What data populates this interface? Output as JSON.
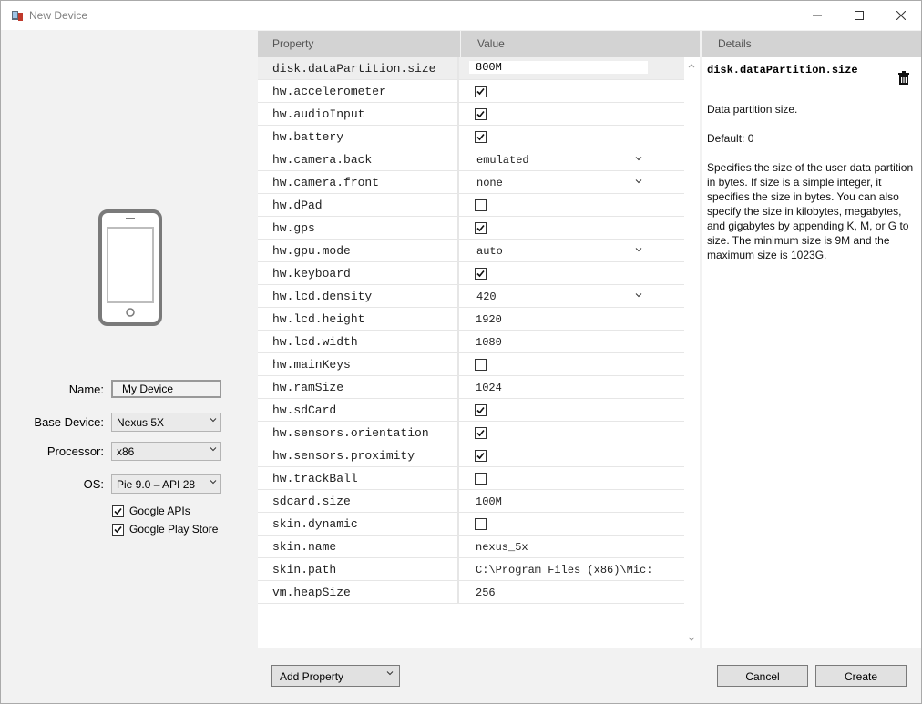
{
  "window": {
    "title": "New Device",
    "icons": [
      "app-icon",
      "minimize-icon",
      "maximize-icon",
      "close-icon"
    ]
  },
  "form": {
    "name_label": "Name:",
    "name_value": "My Device",
    "base_device_label": "Base Device:",
    "base_device_value": "Nexus 5X",
    "processor_label": "Processor:",
    "processor_value": "x86",
    "os_label": "OS:",
    "os_value": "Pie 9.0 – API 28",
    "google_apis_label": "Google APIs",
    "google_apis_checked": true,
    "google_play_label": "Google Play Store",
    "google_play_checked": true
  },
  "grid": {
    "header_property": "Property",
    "header_value": "Value",
    "rows": [
      {
        "name": "disk.dataPartition.size",
        "type": "text",
        "value": "800M",
        "selected": true
      },
      {
        "name": "hw.accelerometer",
        "type": "check",
        "checked": true
      },
      {
        "name": "hw.audioInput",
        "type": "check",
        "checked": true
      },
      {
        "name": "hw.battery",
        "type": "check",
        "checked": true
      },
      {
        "name": "hw.camera.back",
        "type": "combo",
        "value": "emulated"
      },
      {
        "name": "hw.camera.front",
        "type": "combo",
        "value": "none"
      },
      {
        "name": "hw.dPad",
        "type": "check",
        "checked": false
      },
      {
        "name": "hw.gps",
        "type": "check",
        "checked": true
      },
      {
        "name": "hw.gpu.mode",
        "type": "combo",
        "value": "auto"
      },
      {
        "name": "hw.keyboard",
        "type": "check",
        "checked": true
      },
      {
        "name": "hw.lcd.density",
        "type": "combo",
        "value": "420"
      },
      {
        "name": "hw.lcd.height",
        "type": "text",
        "value": "1920"
      },
      {
        "name": "hw.lcd.width",
        "type": "text",
        "value": "1080"
      },
      {
        "name": "hw.mainKeys",
        "type": "check",
        "checked": false
      },
      {
        "name": "hw.ramSize",
        "type": "text",
        "value": "1024"
      },
      {
        "name": "hw.sdCard",
        "type": "check",
        "checked": true
      },
      {
        "name": "hw.sensors.orientation",
        "type": "check",
        "checked": true
      },
      {
        "name": "hw.sensors.proximity",
        "type": "check",
        "checked": true
      },
      {
        "name": "hw.trackBall",
        "type": "check",
        "checked": false
      },
      {
        "name": "sdcard.size",
        "type": "text",
        "value": "100M"
      },
      {
        "name": "skin.dynamic",
        "type": "check",
        "checked": false
      },
      {
        "name": "skin.name",
        "type": "text",
        "value": "nexus_5x"
      },
      {
        "name": "skin.path",
        "type": "text",
        "value": "C:\\Program Files (x86)\\Mic:"
      },
      {
        "name": "vm.heapSize",
        "type": "text",
        "value": "256"
      }
    ]
  },
  "details": {
    "header": "Details",
    "property_name": "disk.dataPartition.size",
    "summary": "Data partition size.",
    "default": "Default: 0",
    "description": "Specifies the size of the user data partition in bytes. If size is a simple integer, it specifies the size in bytes. You can also specify the size in kilobytes, megabytes, and gigabytes by appending K, M, or G to size. The minimum size is 9M and the maximum size is 1023G."
  },
  "buttons": {
    "add_property": "Add Property",
    "cancel": "Cancel",
    "create": "Create"
  }
}
